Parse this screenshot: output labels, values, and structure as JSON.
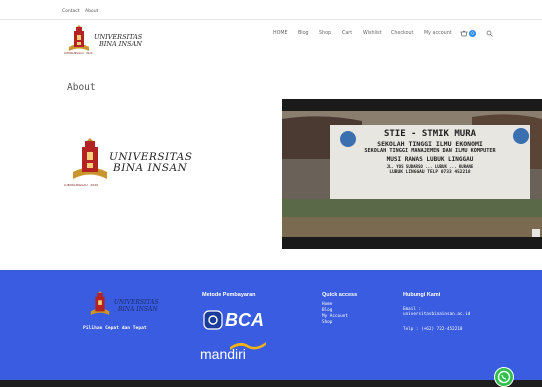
{
  "topbar": {
    "links": [
      "Contact",
      "About"
    ]
  },
  "brand": {
    "name_line1": "UNIVERSITAS",
    "name_line2": "BINA INSAN",
    "tagline": "LUBUKLINGGAU · 2020"
  },
  "nav": {
    "items": [
      "HOME",
      "Blog",
      "Shop",
      "Cart",
      "Wishlist",
      "Checkout",
      "My account"
    ],
    "cart_count": "0"
  },
  "page": {
    "title": "About"
  },
  "photo": {
    "line1": "STIE - STMIK MURA",
    "line2": "SEKOLAH TINGGI ILMU EKONOMI",
    "line3": "SEKOLAH TINGGI MANAJEMEN DAN ILMU KOMPUTER",
    "line4": "MUSI RAWAS LUBUK LINGGAU",
    "line5": "JL. YOS SUDARSO ... LUBUK ... KURANE",
    "line6": "LUBUK LINGGAU TELP 0733 452218"
  },
  "footer": {
    "slogan": "Pilihan Cepat dan Tepat",
    "payment": {
      "heading": "Metode Pembayaran",
      "bank1": "BCA",
      "bank2": "mandiri"
    },
    "quick": {
      "heading": "Quick access",
      "links": [
        "Home",
        "Blog",
        "My Account",
        "Shop"
      ]
    },
    "contact": {
      "heading": "Hubungi Kami",
      "email_label": "Email :",
      "email": "universitasbinainsan.ac.id",
      "phone": "Telp : (+62) 722-452218"
    }
  },
  "colors": {
    "footer_bg": "#3a5ce0",
    "accent": "#2a8cf0",
    "whatsapp": "#2fbf4a"
  },
  "icons": [
    "cart-icon",
    "search-icon",
    "whatsapp-icon",
    "university-tower-icon"
  ]
}
